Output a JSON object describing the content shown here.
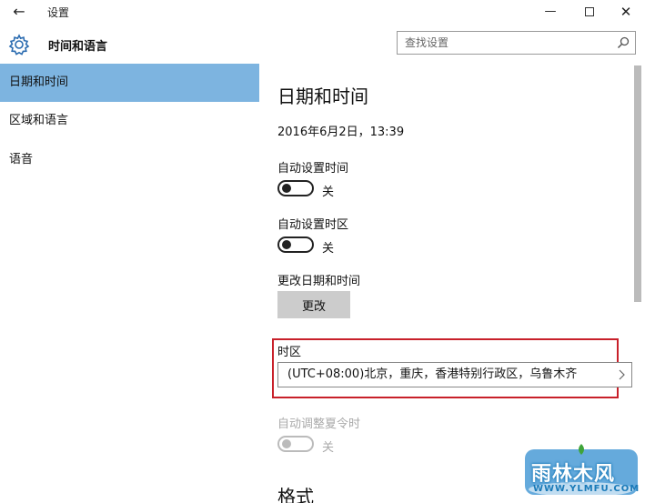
{
  "window": {
    "title": "设置",
    "back_icon": "back-arrow-icon",
    "minimize_glyph": "—",
    "close_glyph": "✕"
  },
  "header": {
    "title": "时间和语言",
    "icon": "gear-icon"
  },
  "search": {
    "placeholder": "查找设置",
    "icon": "search-icon"
  },
  "sidebar": {
    "items": [
      {
        "label": "日期和时间",
        "active": true
      },
      {
        "label": "区域和语言",
        "active": false
      },
      {
        "label": "语音",
        "active": false
      }
    ]
  },
  "main": {
    "page_title": "日期和时间",
    "current_datetime": "2016年6月2日，13:39",
    "auto_time": {
      "label": "自动设置时间",
      "state": "关"
    },
    "auto_timezone": {
      "label": "自动设置时区",
      "state": "关"
    },
    "change_datetime": {
      "label": "更改日期和时间",
      "button": "更改"
    },
    "timezone": {
      "label": "时区",
      "value": "(UTC+08:00)北京，重庆，香港特别行政区，乌鲁木齐"
    },
    "dst": {
      "label": "自动调整夏令时",
      "state": "关",
      "disabled": true
    },
    "format_title": "格式"
  },
  "watermark": {
    "text": "雨林木风",
    "url": "WWW.YLMFU.COM"
  },
  "colors": {
    "active_nav": "#7db4e0",
    "highlight_box": "#c8202a",
    "button_bg": "#cccccc"
  }
}
